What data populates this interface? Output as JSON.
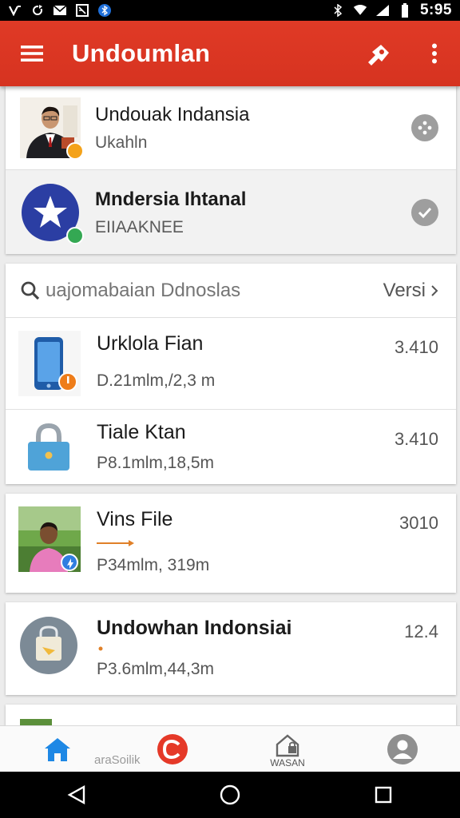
{
  "status_bar": {
    "time": "5:95",
    "left_icons": [
      "signal-hook-icon",
      "sync-icon",
      "mail-icon",
      "news-icon",
      "bluetooth-icon"
    ],
    "right_icons": [
      "bluetooth-icon",
      "wifi-icon",
      "cell-signal-icon",
      "battery-icon"
    ]
  },
  "app_bar": {
    "title": "Undoumlan",
    "color": "#dd3823"
  },
  "accounts": [
    {
      "title": "Undouak Indansia",
      "subtitle": "Ukahln",
      "avatar": "person-avatar",
      "action_icon": "dots-circle-icon"
    },
    {
      "title": "Mndersia Ihtanal",
      "subtitle": "EIIAAKNEE",
      "avatar": "star-avatar",
      "action_icon": "check-circle-icon"
    }
  ],
  "search": {
    "placeholder": "uajomabaian Ddnoslas",
    "version_label": "Versi"
  },
  "files": [
    {
      "title": "Urklola Fian",
      "meta": "D.21mlm,/2,3 m",
      "number": "3.410",
      "thumb": "phone-icon"
    },
    {
      "title": "Tiale Ktan",
      "meta": "P8.1mlm,18,5m",
      "number": "3.410",
      "thumb": "lock-icon"
    },
    {
      "title": "Vins File",
      "meta": "P34mlm, 319m",
      "number": "3010",
      "thumb": "person-photo",
      "progress": 0.5
    },
    {
      "title": "Undowhan Indonsiai",
      "meta": "P3.6mlm,44,3m",
      "number": "12.4",
      "thumb": "bag-icon"
    }
  ],
  "bottom_nav": {
    "left_label": "araSoilik",
    "items": [
      {
        "icon": "home-icon",
        "label": ""
      },
      {
        "icon": "download-c-icon",
        "label": ""
      },
      {
        "icon": "house-lock-icon",
        "label": "WASAN"
      },
      {
        "icon": "profile-icon",
        "label": ""
      }
    ]
  },
  "colors": {
    "accent": "#dd3823",
    "home_blue": "#1e88e5",
    "star_blue": "#2b3ea3"
  }
}
